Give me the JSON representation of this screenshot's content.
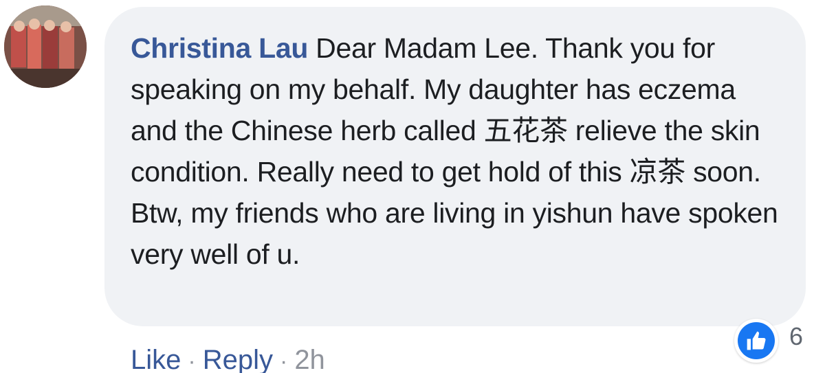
{
  "comment": {
    "author": "Christina Lau",
    "body": "Dear Madam Lee. Thank you for speaking on my behalf. My daughter has eczema and the Chinese herb called 五花茶 relieve the skin condition. Really need to get hold of this 凉茶 soon.\nBtw, my friends who are living in yishun have spoken very well of u.",
    "reaction_count": "6",
    "reaction_icon": "like-icon"
  },
  "actions": {
    "like_label": "Like",
    "reply_label": "Reply",
    "separator": "·",
    "timestamp": "2h"
  },
  "colors": {
    "author": "#385898",
    "bubble": "#f0f2f5",
    "like_blue": "#1877f2",
    "meta_grey": "#90949c"
  }
}
